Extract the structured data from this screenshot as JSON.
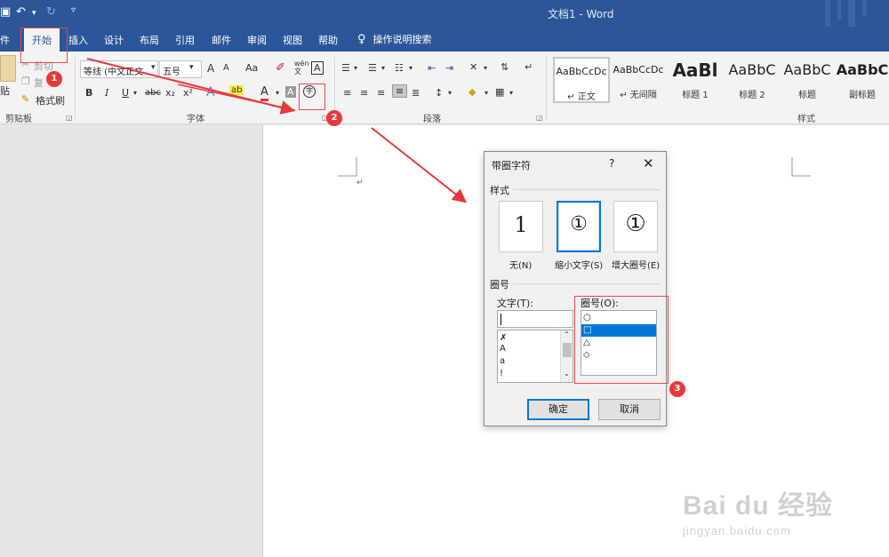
{
  "titlebar": {
    "doc_title": "文档1 - Word",
    "undo": "↶",
    "redo": "↻",
    "customize": "▿"
  },
  "tabs": {
    "file": "件",
    "home": "开始",
    "insert": "插入",
    "design": "设计",
    "layout": "布局",
    "references": "引用",
    "mailings": "邮件",
    "review": "审阅",
    "view": "视图",
    "help": "帮助",
    "tell_me": "操作说明搜索"
  },
  "clipboard": {
    "paste": "贴",
    "cut": "剪切",
    "copy": "复",
    "format_painter": "格式刷",
    "group_label": "剪贴板"
  },
  "font": {
    "font_name": "等线 (中文正文",
    "font_size": "五号",
    "grow": "A",
    "shrink": "A",
    "change_case": "Aa",
    "clear": "✐",
    "phonetic": "wén\n文",
    "border": "A",
    "bold": "B",
    "italic": "I",
    "underline": "U",
    "strike": "abc",
    "subscript": "x₂",
    "superscript": "x²",
    "text_effect": "A",
    "font_color": "A",
    "shading": "A",
    "enclose": "字",
    "group_label": "字体"
  },
  "paragraph": {
    "group_label": "段落"
  },
  "styles": {
    "group_label": "样式",
    "items": [
      {
        "sample": "AaBbCcDc",
        "name": "↵ 正文"
      },
      {
        "sample": "AaBbCcDc",
        "name": "↵ 无间隔"
      },
      {
        "sample": "AaBl",
        "name": "标题 1"
      },
      {
        "sample": "AaBbC",
        "name": "标题 2"
      },
      {
        "sample": "AaBbC",
        "name": "标题"
      },
      {
        "sample": "AaBbC",
        "name": "副标题"
      }
    ]
  },
  "dialog": {
    "title": "带圈字符",
    "help": "?",
    "close": "✕",
    "style_section": "样式",
    "styles": [
      {
        "glyph": "1",
        "label": "无(N)"
      },
      {
        "glyph": "①",
        "label": "缩小文字(S)"
      },
      {
        "glyph": "①",
        "label": "增大圈号(E)"
      }
    ],
    "enclose_section": "圈号",
    "text_label": "文字(T):",
    "text_value": "",
    "text_items": [
      "✗",
      "A",
      "a",
      "!"
    ],
    "enclosure_label": "圈号(O):",
    "enclosure_items": [
      "○",
      "□",
      "△",
      "◇"
    ],
    "enclosure_selected": 1,
    "ok": "确定",
    "cancel": "取消"
  },
  "annotations": {
    "badges": [
      "1",
      "2",
      "3"
    ],
    "color": "#e8393a"
  },
  "watermark": {
    "brand": "Bai du 经验",
    "url": "jingyan.baidu.com"
  },
  "colors": {
    "accent": "#2b579a",
    "selection": "#0078d7"
  }
}
